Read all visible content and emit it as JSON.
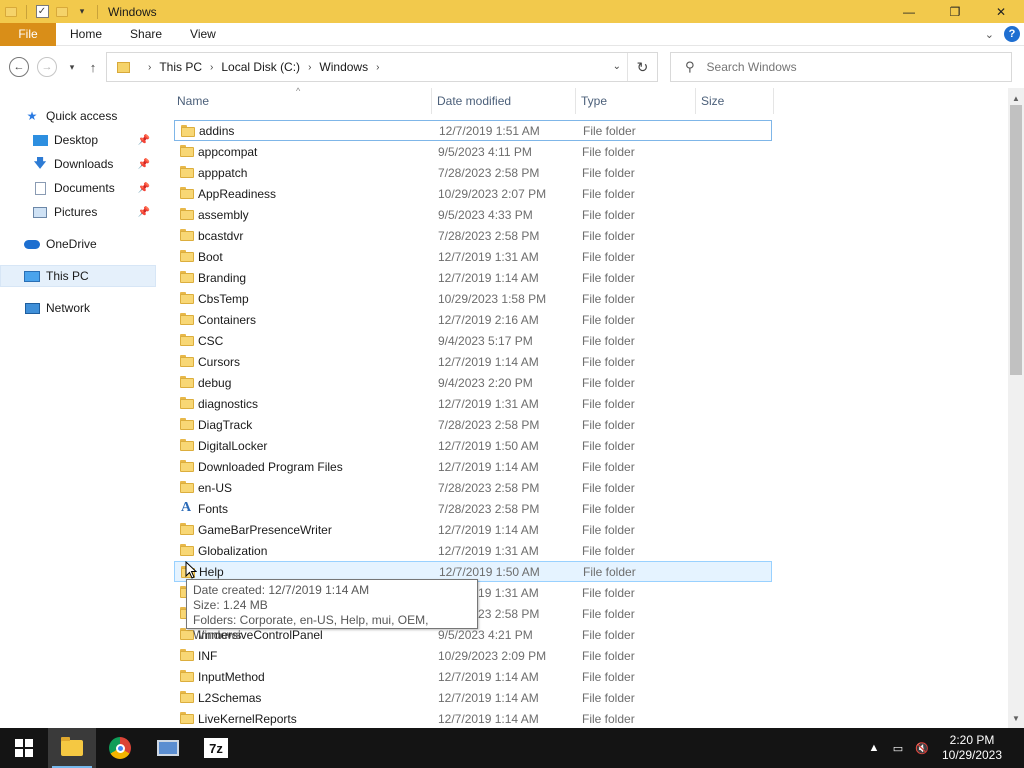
{
  "window": {
    "title": "Windows",
    "minimize_glyph": "—",
    "maximize_glyph": "❐",
    "close_glyph": "✕"
  },
  "ribbon": {
    "tabs": [
      "File",
      "Home",
      "Share",
      "View"
    ],
    "help_glyph": "?"
  },
  "address": {
    "crumbs": [
      "This PC",
      "Local Disk (C:)",
      "Windows"
    ],
    "separator": "›"
  },
  "search": {
    "placeholder": "Search Windows"
  },
  "nav_pane": {
    "items": [
      {
        "label": "Quick access",
        "icon": "star-icon"
      },
      {
        "label": "Desktop",
        "icon": "desktop-icon",
        "pinned": true
      },
      {
        "label": "Downloads",
        "icon": "download-arrow-icon",
        "pinned": true
      },
      {
        "label": "Documents",
        "icon": "document-icon",
        "pinned": true
      },
      {
        "label": "Pictures",
        "icon": "picture-icon",
        "pinned": true
      },
      {
        "label": "OneDrive",
        "icon": "cloud-icon"
      },
      {
        "label": "This PC",
        "icon": "computer-icon",
        "selected": true
      },
      {
        "label": "Network",
        "icon": "network-icon"
      }
    ]
  },
  "columns": {
    "name": "Name",
    "date": "Date modified",
    "type": "Type",
    "size": "Size"
  },
  "files": [
    {
      "name": "addins",
      "date": "12/7/2019 1:51 AM",
      "type": "File folder"
    },
    {
      "name": "appcompat",
      "date": "9/5/2023 4:11 PM",
      "type": "File folder"
    },
    {
      "name": "apppatch",
      "date": "7/28/2023 2:58 PM",
      "type": "File folder"
    },
    {
      "name": "AppReadiness",
      "date": "10/29/2023 2:07 PM",
      "type": "File folder"
    },
    {
      "name": "assembly",
      "date": "9/5/2023 4:33 PM",
      "type": "File folder"
    },
    {
      "name": "bcastdvr",
      "date": "7/28/2023 2:58 PM",
      "type": "File folder"
    },
    {
      "name": "Boot",
      "date": "12/7/2019 1:31 AM",
      "type": "File folder"
    },
    {
      "name": "Branding",
      "date": "12/7/2019 1:14 AM",
      "type": "File folder"
    },
    {
      "name": "CbsTemp",
      "date": "10/29/2023 1:58 PM",
      "type": "File folder"
    },
    {
      "name": "Containers",
      "date": "12/7/2019 2:16 AM",
      "type": "File folder"
    },
    {
      "name": "CSC",
      "date": "9/4/2023 5:17 PM",
      "type": "File folder"
    },
    {
      "name": "Cursors",
      "date": "12/7/2019 1:14 AM",
      "type": "File folder"
    },
    {
      "name": "debug",
      "date": "9/4/2023 2:20 PM",
      "type": "File folder"
    },
    {
      "name": "diagnostics",
      "date": "12/7/2019 1:31 AM",
      "type": "File folder"
    },
    {
      "name": "DiagTrack",
      "date": "7/28/2023 2:58 PM",
      "type": "File folder"
    },
    {
      "name": "DigitalLocker",
      "date": "12/7/2019 1:50 AM",
      "type": "File folder"
    },
    {
      "name": "Downloaded Program Files",
      "date": "12/7/2019 1:14 AM",
      "type": "File folder"
    },
    {
      "name": "en-US",
      "date": "7/28/2023 2:58 PM",
      "type": "File folder"
    },
    {
      "name": "Fonts",
      "date": "7/28/2023 2:58 PM",
      "type": "File folder"
    },
    {
      "name": "GameBarPresenceWriter",
      "date": "12/7/2019 1:14 AM",
      "type": "File folder"
    },
    {
      "name": "Globalization",
      "date": "12/7/2019 1:31 AM",
      "type": "File folder"
    },
    {
      "name": "Help",
      "date": "12/7/2019 1:50 AM",
      "type": "File folder"
    },
    {
      "name": "",
      "date": "12/7/2019 1:31 AM",
      "type": "File folder"
    },
    {
      "name": "",
      "date": "7/28/2023 2:58 PM",
      "type": "File folder"
    },
    {
      "name": "ImmersiveControlPanel",
      "date": "9/5/2023 4:21 PM",
      "type": "File folder"
    },
    {
      "name": "INF",
      "date": "10/29/2023 2:09 PM",
      "type": "File folder"
    },
    {
      "name": "InputMethod",
      "date": "12/7/2019 1:14 AM",
      "type": "File folder"
    },
    {
      "name": "L2Schemas",
      "date": "12/7/2019 1:14 AM",
      "type": "File folder"
    },
    {
      "name": "LiveKernelReports",
      "date": "12/7/2019 1:14 AM",
      "type": "File folder"
    }
  ],
  "tooltip": {
    "line1": "Date created: 12/7/2019 1:14 AM",
    "line2": "Size: 1.24 MB",
    "line3": "Folders: Corporate, en-US, Help, mui, OEM, Windows"
  },
  "taskbar": {
    "seven_zip_label": "7z",
    "clock_time": "2:20 PM",
    "clock_date": "10/29/2023"
  }
}
